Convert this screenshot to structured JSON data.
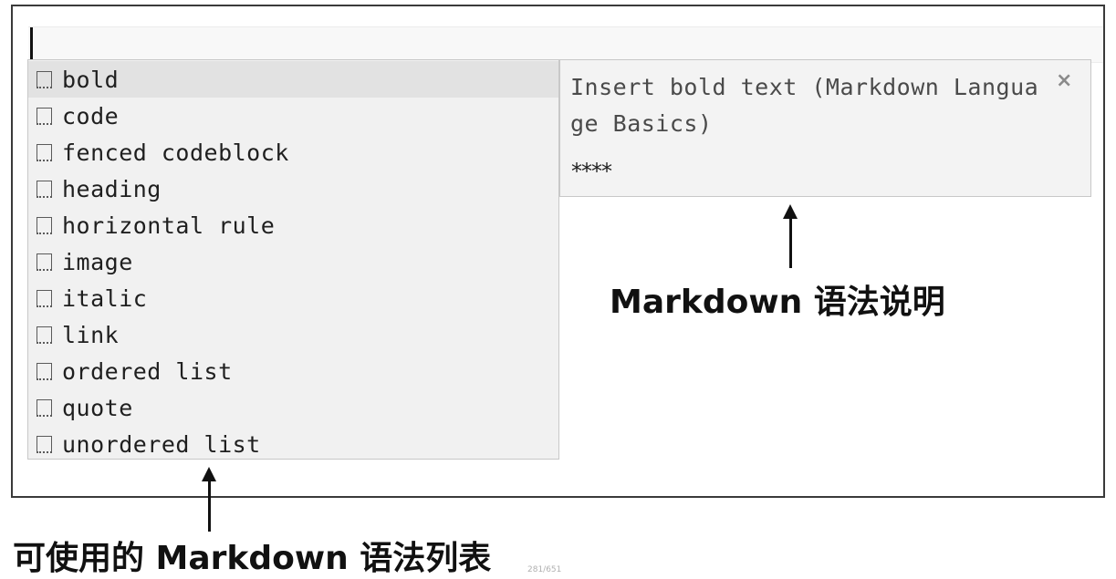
{
  "hints": {
    "items": [
      {
        "label": "bold",
        "icon": "snippet-icon"
      },
      {
        "label": "code",
        "icon": "snippet-icon"
      },
      {
        "label": "fenced codeblock",
        "icon": "snippet-icon"
      },
      {
        "label": "heading",
        "icon": "snippet-icon"
      },
      {
        "label": "horizontal rule",
        "icon": "snippet-icon"
      },
      {
        "label": "image",
        "icon": "snippet-icon"
      },
      {
        "label": "italic",
        "icon": "snippet-icon"
      },
      {
        "label": "link",
        "icon": "snippet-icon"
      },
      {
        "label": "ordered list",
        "icon": "snippet-icon"
      },
      {
        "label": "quote",
        "icon": "snippet-icon"
      },
      {
        "label": "unordered list",
        "icon": "snippet-icon"
      }
    ],
    "selected_index": 0
  },
  "doc": {
    "description": "Insert bold text (Markdown Language Basics)",
    "close_glyph": "×",
    "snippet": "****"
  },
  "callouts": {
    "doc_label": "Markdown 语法说明",
    "list_label": "可使用的 Markdown 语法列表"
  },
  "page_number": "281/651"
}
